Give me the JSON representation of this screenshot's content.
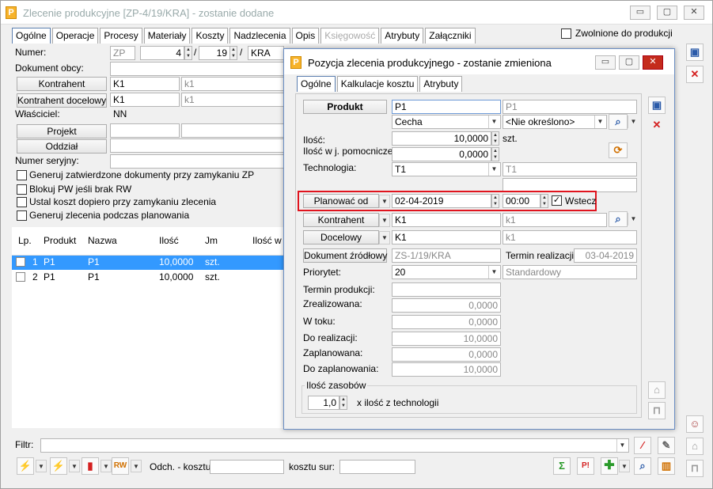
{
  "window": {
    "title": "Zlecenie produkcyjne  [ZP-4/19/KRA] - zostanie dodane",
    "icon": "P"
  },
  "main_tabs": [
    "Ogólne",
    "Operacje",
    "Procesy",
    "Materiały",
    "Koszty",
    "Nadzlecenia",
    "Opis",
    "Księgowość",
    "Atrybuty",
    "Załączniki"
  ],
  "zwolnione_label": "Zwolnione do produkcji",
  "form": {
    "numer_label": "Numer:",
    "numer_prefix": "ZP",
    "numer_num": "4",
    "numer_year": "19",
    "numer_sep": "/",
    "numer_series": "KRA",
    "dokument_obcy_label": "Dokument obcy:",
    "kontrahent_btn": "Kontrahent",
    "kontrahent_code": "K1",
    "kontrahent_name": "k1",
    "kontrahent_doc_btn": "Kontrahent docelowy",
    "kontrahent_doc_code": "K1",
    "kontrahent_doc_name": "k1",
    "wlasciciel_label": "Właściciel:",
    "wlasciciel_value": "NN",
    "projekt_btn": "Projekt",
    "oddzial_btn": "Oddział",
    "numer_seryjny_label": "Numer seryjny:"
  },
  "checks": [
    "Generuj zatwierdzone dokumenty przy zamykaniu ZP",
    "Blokuj PW jeśli brak RW",
    "Ustal koszt dopiero przy zamykaniu zlecenia",
    "Generuj zlecenia podczas planowania"
  ],
  "grid": {
    "headers": {
      "lp": "Lp.",
      "produkt": "Produkt",
      "nazwa": "Nazwa",
      "ilosc": "Ilość",
      "jm": "Jm",
      "ilosc_w": "Ilość w j"
    },
    "rows": [
      {
        "lp": "1",
        "produkt": "P1",
        "nazwa": "P1",
        "ilosc": "10,0000",
        "jm": "szt."
      },
      {
        "lp": "2",
        "produkt": "P1",
        "nazwa": "P1",
        "ilosc": "10,0000",
        "jm": "szt."
      }
    ]
  },
  "bottom": {
    "filtr_label": "Filtr:",
    "odch_label": "Odch. - kosztu:",
    "kosztu_sur_label": "kosztu sur:"
  },
  "dialog": {
    "title": "Pozycja zlecenia produkcyjnego - zostanie zmieniona",
    "tabs": [
      "Ogólne",
      "Kalkulacje kosztu",
      "Atrybuty"
    ],
    "produkt_btn": "Produkt",
    "produkt_code": "P1",
    "produkt_name": "P1",
    "cecha": "Cecha",
    "cecha_value": "<Nie określono>",
    "ilosc_label": "Ilość:",
    "ilosc_value": "10,0000",
    "ilosc_unit": "szt.",
    "ilosc_pom_label": "Ilość w j. pomocniczej:",
    "ilosc_pom_value": "0,0000",
    "technologia_label": "Technologia:",
    "technologia_code": "T1",
    "technologia_name": "T1",
    "planowac_btn": "Planować od",
    "planowac_date": "02-04-2019",
    "planowac_time": "00:00",
    "wstecz_label": "Wstecz",
    "kontrahent_btn": "Kontrahent",
    "kontrahent_code": "K1",
    "kontrahent_name": "k1",
    "docelowy_btn": "Docelowy",
    "docelowy_code": "K1",
    "docelowy_name": "k1",
    "dokument_btn": "Dokument źródłowy",
    "dokument_value": "ZS-1/19/KRA",
    "termin_real_label": "Termin realizacji:",
    "termin_real_value": "03-04-2019",
    "priorytet_label": "Priorytet:",
    "priorytet_value": "20",
    "priorytet_name": "Standardowy",
    "termin_prod_label": "Termin produkcji:",
    "zrealizowana_label": "Zrealizowana:",
    "zrealizowana_value": "0,0000",
    "wtoku_label": "W toku:",
    "wtoku_value": "0,0000",
    "dorealizacji_label": "Do realizacji:",
    "dorealizacji_value": "10,0000",
    "zaplanowana_label": "Zaplanowana:",
    "zaplanowana_value": "0,0000",
    "dozaplanowania_label": "Do zaplanowania:",
    "dozaplanowania_value": "10,0000",
    "ilosc_zasobow_label": "Ilość zasobów",
    "zasoby_value": "1,0",
    "zasoby_suffix": "x ilość z technologii"
  },
  "colors": {
    "accent": "#3399ff",
    "highlight": "#e0141e",
    "save": "#2a5aa8",
    "cancel": "#d42020"
  }
}
